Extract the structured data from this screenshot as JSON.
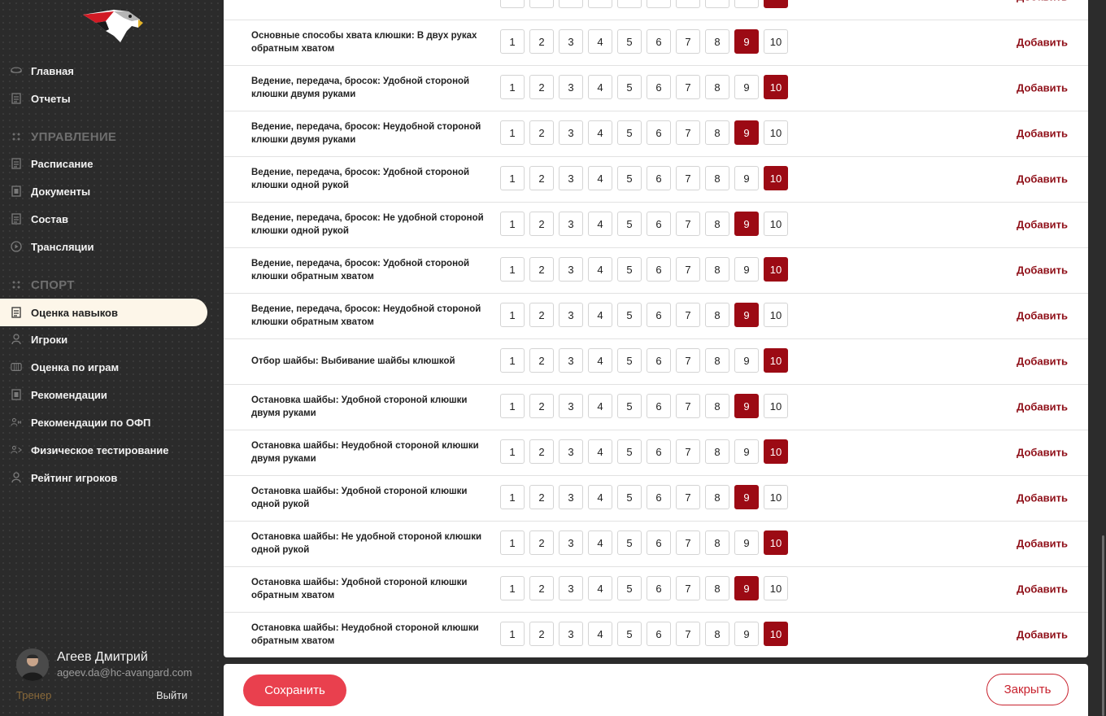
{
  "sidebar": {
    "items_top": [
      {
        "icon": "puck-icon",
        "label": "Главная"
      },
      {
        "icon": "report-icon",
        "label": "Отчеты"
      }
    ],
    "section_management": "УПРАВЛЕНИЕ",
    "items_management": [
      {
        "icon": "calendar-doc-icon",
        "label": "Расписание"
      },
      {
        "icon": "document-icon",
        "label": "Документы"
      },
      {
        "icon": "roster-icon",
        "label": "Состав"
      },
      {
        "icon": "play-circle-icon",
        "label": "Трансляции"
      }
    ],
    "section_sport": "СПОРТ",
    "items_sport": [
      {
        "icon": "checklist-icon",
        "label": "Оценка навыков",
        "active": true
      },
      {
        "icon": "player-icon",
        "label": "Игроки"
      },
      {
        "icon": "rink-icon",
        "label": "Оценка по играм"
      },
      {
        "icon": "document-icon",
        "label": "Рекомендации"
      },
      {
        "icon": "dumbbell-icon",
        "label": "Рекомендации по ОФП"
      },
      {
        "icon": "runner-icon",
        "label": "Физическое тестирование"
      },
      {
        "icon": "player-icon",
        "label": "Рейтинг игроков"
      }
    ],
    "profile": {
      "name": "Агеев Дмитрий",
      "email": "ageev.da@hc-avangard.com",
      "role": "Тренер",
      "logout": "Выйти"
    }
  },
  "scale_labels": [
    "1",
    "2",
    "3",
    "4",
    "5",
    "6",
    "7",
    "8",
    "9",
    "10"
  ],
  "add_label": "Добавить",
  "skills": [
    {
      "name": "",
      "selected": 10
    },
    {
      "name": "Основные способы хвата клюшки: В двух руках обратным хватом",
      "selected": 9
    },
    {
      "name": "Ведение, передача, бросок: Удобной стороной клюшки двумя руками",
      "selected": 10
    },
    {
      "name": "Ведение, передача, бросок: Неудобной стороной клюшки двумя руками",
      "selected": 9
    },
    {
      "name": "Ведение, передача, бросок: Удобной стороной клюшки одной рукой",
      "selected": 10
    },
    {
      "name": "Ведение, передача, бросок: Не удобной стороной клюшки одной рукой",
      "selected": 9
    },
    {
      "name": "Ведение, передача, бросок: Удобной стороной клюшки обратным хватом",
      "selected": 10
    },
    {
      "name": "Ведение, передача, бросок: Неудобной стороной клюшки обратным хватом",
      "selected": 9
    },
    {
      "name": "Отбор шайбы: Выбивание шайбы клюшкой",
      "selected": 10
    },
    {
      "name": "Остановка шайбы: Удобной стороной клюшки двумя руками",
      "selected": 9
    },
    {
      "name": "Остановка шайбы: Неудобной стороной клюшки двумя руками",
      "selected": 10
    },
    {
      "name": "Остановка шайбы: Удобной стороной клюшки одной рукой",
      "selected": 9
    },
    {
      "name": "Остановка шайбы: Не удобной стороной клюшки одной рукой",
      "selected": 10
    },
    {
      "name": "Остановка шайбы: Удобной стороной клюшки обратным хватом",
      "selected": 9
    },
    {
      "name": "Остановка шайбы: Неудобной стороной клюшки обратным хватом",
      "selected": 10
    }
  ],
  "footer": {
    "save_label": "Сохранить",
    "close_label": "Закрыть"
  },
  "colors": {
    "accent": "#9c0a14",
    "save_button": "#e9404e",
    "sidebar_bg": "#2b2b2b",
    "active_item_bg": "#fdf6e9"
  }
}
